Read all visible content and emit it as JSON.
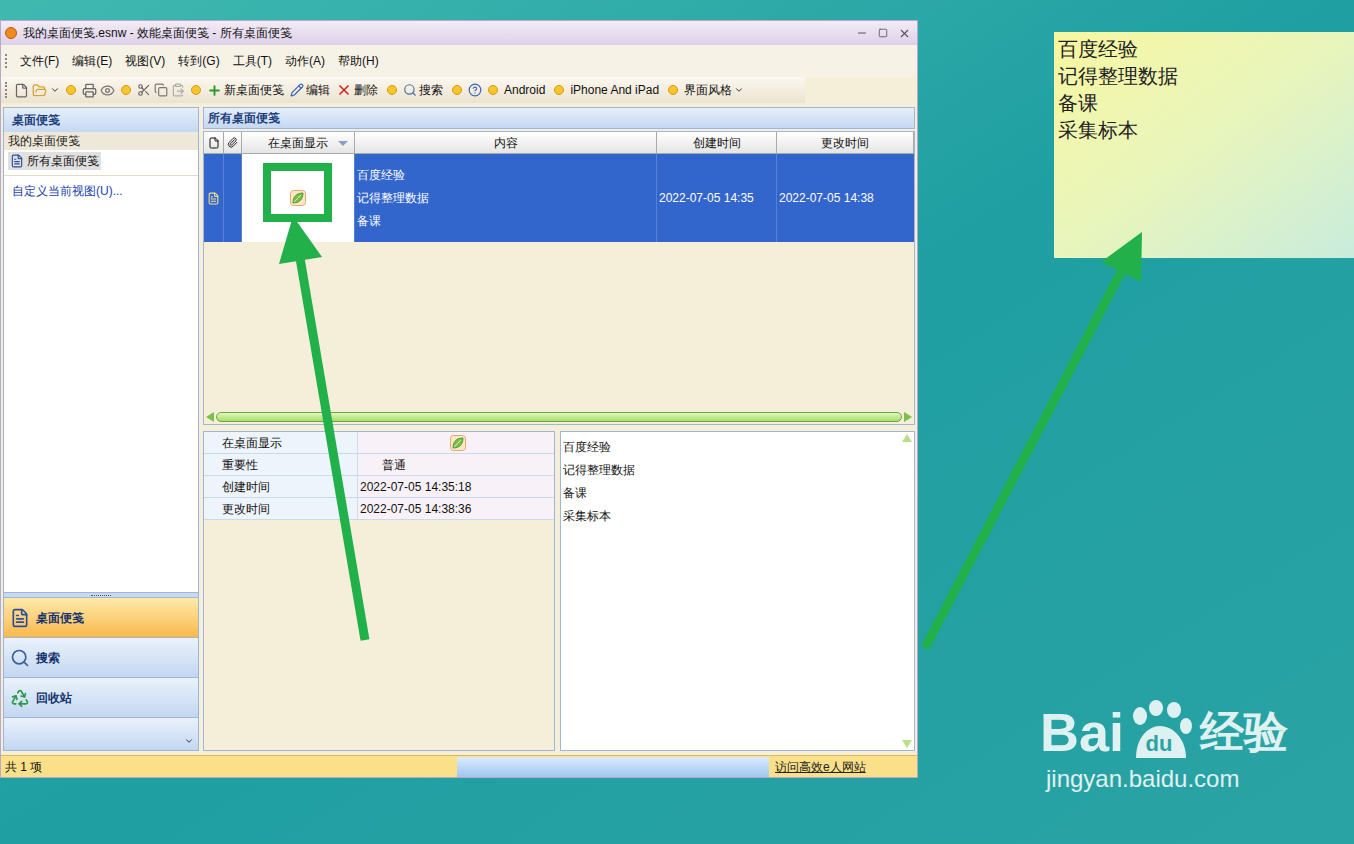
{
  "window": {
    "title": "我的桌面便笺.esnw - 效能桌面便笺 - 所有桌面便笺"
  },
  "menu": [
    "文件(F)",
    "编辑(E)",
    "视图(V)",
    "转到(G)",
    "工具(T)",
    "动作(A)",
    "帮助(H)"
  ],
  "toolbar": [
    {
      "label": "新桌面便笺",
      "kind": "new"
    },
    {
      "label": "编辑",
      "kind": "edit"
    },
    {
      "label": "删除",
      "kind": "delete"
    },
    {
      "label": "搜索",
      "kind": "search"
    },
    {
      "label": "Android",
      "kind": "plain"
    },
    {
      "label": "iPhone And iPad",
      "kind": "plain"
    },
    {
      "label": "界面风格",
      "kind": "dropdown"
    }
  ],
  "sidebar": {
    "header": "桌面便笺",
    "group": "我的桌面便笺",
    "items": [
      {
        "label": "所有桌面便笺",
        "selected": true
      }
    ],
    "link": "自定义当前视图(U)...",
    "nav": [
      {
        "label": "桌面便笺",
        "kind": "notes",
        "selected": true
      },
      {
        "label": "搜索",
        "kind": "search",
        "selected": false
      },
      {
        "label": "回收站",
        "kind": "recycle",
        "selected": false
      }
    ]
  },
  "list": {
    "header": "所有桌面便笺",
    "columns": [
      {
        "label": "",
        "kind": "doc"
      },
      {
        "label": "",
        "kind": "attach"
      },
      {
        "label": "在桌面显示",
        "kind": "sorted"
      },
      {
        "label": "内容",
        "kind": "text"
      },
      {
        "label": "创建时间",
        "kind": "text"
      },
      {
        "label": "更改时间",
        "kind": "text"
      }
    ],
    "rows": [
      {
        "on_desktop": true,
        "content": [
          "百度经验",
          "记得整理数据",
          "备课"
        ],
        "created": "2022-07-05 14:35",
        "modified": "2022-07-05 14:38",
        "selected": true
      }
    ]
  },
  "details": [
    {
      "label": "在桌面显示",
      "kind": "leaf",
      "on": true
    },
    {
      "label": "重要性",
      "kind": "text",
      "value": "普通"
    },
    {
      "label": "创建时间",
      "kind": "text",
      "value": "2022-07-05 14:35:18"
    },
    {
      "label": "更改时间",
      "kind": "text",
      "value": "2022-07-05 14:38:36"
    }
  ],
  "preview": [
    "百度经验",
    "记得整理数据",
    "备课",
    "采集标本"
  ],
  "status_bar": {
    "count": "共 1 项",
    "link": "访问高效e人网站"
  },
  "sticky_note": [
    "百度经验",
    "记得整理数据",
    "备课",
    "采集标本"
  ],
  "watermark": {
    "brand": "Bai",
    "paw": "du",
    "suffix": "经验",
    "url": "jingyan.baidu.com"
  }
}
